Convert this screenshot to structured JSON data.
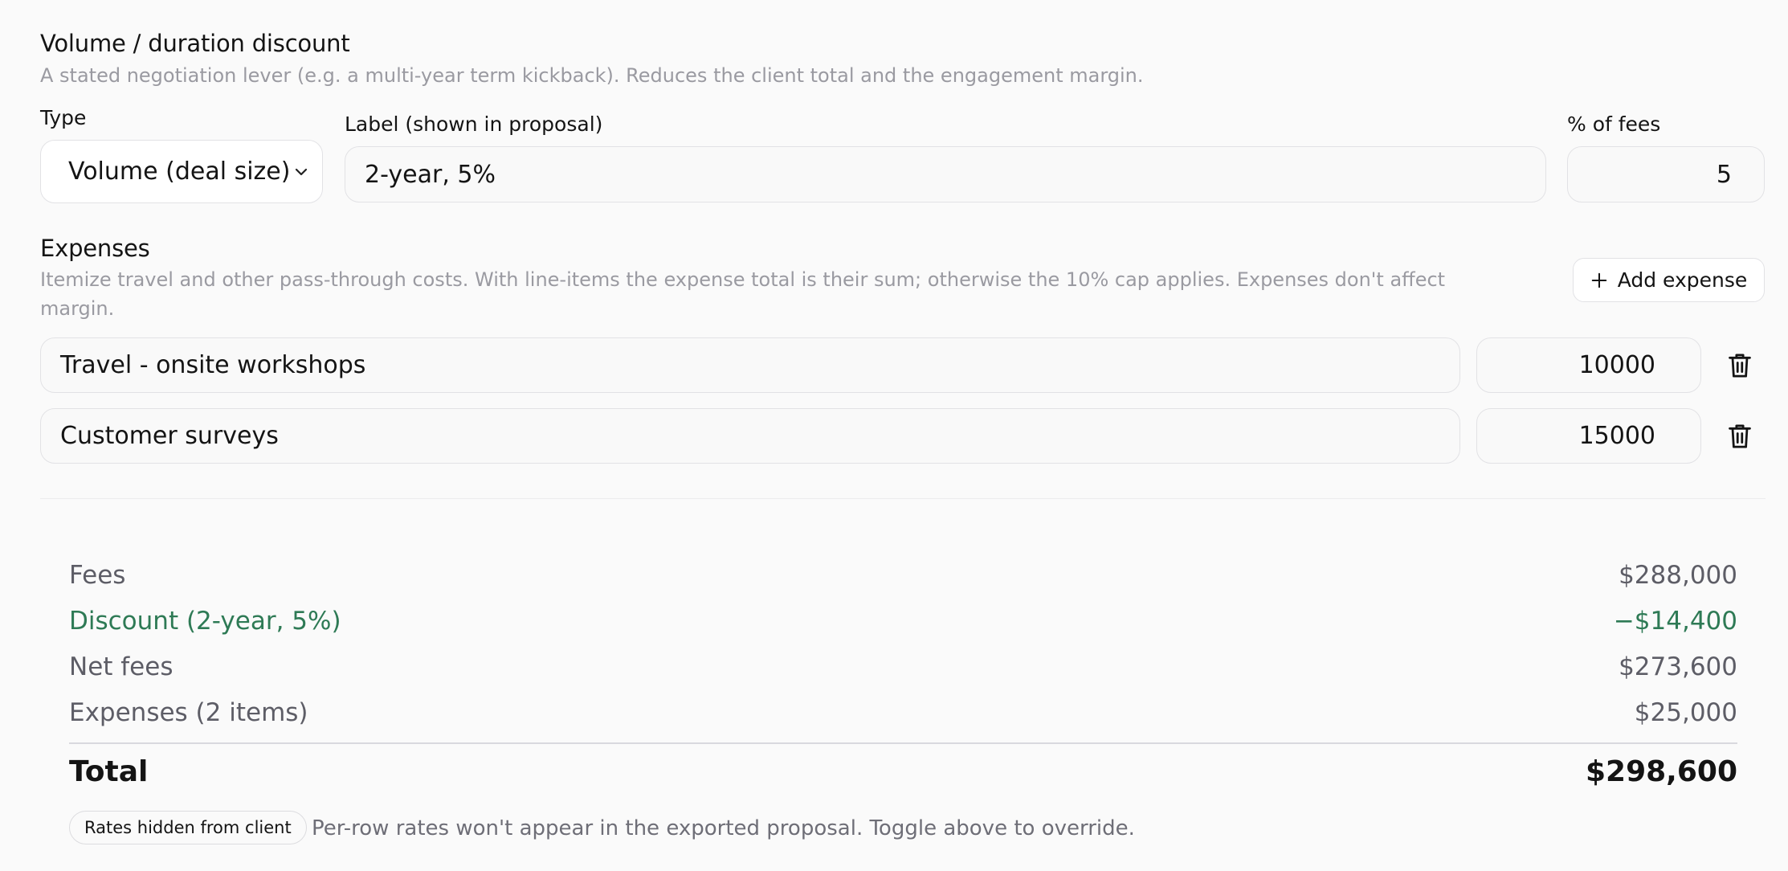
{
  "discount": {
    "title": "Volume / duration discount",
    "hint": "A stated negotiation lever (e.g. a multi-year term kickback). Reduces the client total and the engagement margin.",
    "type_label": "Type",
    "type_value": "Volume (deal size)",
    "label_label": "Label (shown in proposal)",
    "label_value": "2-year, 5%",
    "pct_label": "% of fees",
    "pct_value": "5"
  },
  "expenses": {
    "title": "Expenses",
    "hint": "Itemize travel and other pass-through costs. With line-items the expense total is their sum; otherwise the 10% cap applies. Expenses don't affect margin.",
    "add_label": "Add expense",
    "items": [
      {
        "name": "Travel - onsite workshops",
        "amount": "10000"
      },
      {
        "name": "Customer surveys",
        "amount": "15000"
      }
    ]
  },
  "summary": {
    "fees_label": "Fees",
    "fees_value": "$288,000",
    "discount_label": "Discount (2-year, 5%)",
    "discount_value": "−$14,400",
    "net_label": "Net fees",
    "net_value": "$273,600",
    "expenses_label": "Expenses (2 items)",
    "expenses_value": "$25,000",
    "total_label": "Total",
    "total_value": "$298,600"
  },
  "footer": {
    "badge": "Rates hidden from client",
    "note": "Per-row rates won't appear in the exported proposal. Toggle above to override."
  },
  "colors": {
    "discount_green": "#2e7a55",
    "muted_text": "#9a9aa1",
    "border": "#e2e2e5"
  },
  "icons": {
    "select": "chevron-down-icon",
    "add": "plus-icon",
    "delete": "trash-icon"
  }
}
